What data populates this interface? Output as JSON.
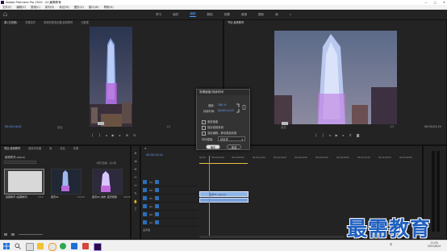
{
  "window": {
    "title": "Adobe Premiere Pro 2020 - D:\\最需教育",
    "minimize": "—",
    "maximize": "□",
    "close": "✕"
  },
  "menu": [
    "文件(F)",
    "编辑(E)",
    "剪辑(C)",
    "序列(S)",
    "标记(M)",
    "图形(G)",
    "窗口(W)",
    "帮助(H)"
  ],
  "workspaces": {
    "items": [
      "学习",
      "组件",
      "编辑",
      "颜色",
      "效果",
      "音频",
      "图形",
      "库"
    ],
    "active_index": 2,
    "overflow": "»"
  },
  "source_monitor": {
    "tabs": [
      "源:(无剪辑)",
      "效果控件",
      "音频剪辑混合器:最需教育",
      "元数据"
    ],
    "timecode_left": "00;00;14;02",
    "fit": "适合",
    "fraction": "1/2"
  },
  "program_monitor": {
    "tab": "节目:最需教育",
    "timecode_left": "00;00;14;02",
    "fit": "适合",
    "fraction": "1/2",
    "timecode_right": "00;00;01;15"
  },
  "dialog": {
    "title": "剪辑速度/持续时间",
    "speed_label": "速度:",
    "speed_value": "100 %",
    "duration_label": "持续时间:",
    "duration_value": "00;00;14;15",
    "link_icon": "chain-link-icon",
    "reset_icon": "reset-icon",
    "checkboxes": [
      "倒放速度",
      "保持音频音调",
      "波纹编辑，移动尾部剪辑"
    ],
    "interp_label": "时间插值:",
    "interp_value": "帧采样",
    "ok": "确定",
    "cancel": "取消"
  },
  "project_panel": {
    "tabs": [
      "项目:最需教育",
      "媒体浏览器",
      "库",
      "信息",
      "效果"
    ],
    "file": "最需教育.prproj",
    "count": "1项已选择，共4项",
    "clips": [
      {
        "name": "最需教育 (最需教育)",
        "duration": "3:11"
      },
      {
        "name": "夜景01",
        "duration": "14:15"
      },
      {
        "name": "夜景02_城市_夜景视频",
        "duration": "14:15"
      }
    ]
  },
  "timeline": {
    "timecode": "00;00;14;14",
    "ruler": [
      "00;00",
      "00;00;04;00",
      "00;00;08;00",
      "00;00;12;00",
      "00;00;16;00",
      "00;00;20;00",
      "00;00;24;00",
      "00;00;28;00",
      "00;00;32;00",
      "00;00;36;00",
      "00;00;40;00"
    ],
    "video_tracks": [
      "V3",
      "V2",
      "V1"
    ],
    "audio_tracks": [
      "A1",
      "A2",
      "A3"
    ],
    "clip_label": "夜景01.mp4 [V]",
    "master_label": "主声道"
  },
  "taskbar": {
    "search_icon": "search-icon",
    "time": "11:00",
    "date": "2021/6/24",
    "lang": "中"
  },
  "watermark": "最需教育",
  "colors": {
    "accent": "#4b9bff",
    "clip_blue": "#8fb4e6",
    "watermark": "#1f5fbf",
    "yellow_bar": "#e8c04a"
  }
}
